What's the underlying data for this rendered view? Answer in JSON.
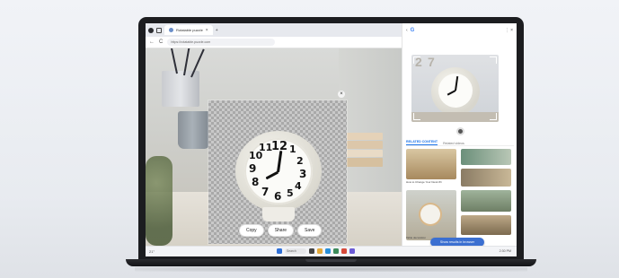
{
  "browser": {
    "tab_title": "Rotatable puzzle",
    "tab_close": "×",
    "tab_new": "+",
    "url": "https://rotatable.puzzle.com",
    "nav_back": "←",
    "nav_forward": "→",
    "nav_reload": "C"
  },
  "image": {
    "clock_numerals": [
      "12",
      "1",
      "2",
      "3",
      "4",
      "5",
      "6",
      "7",
      "8",
      "9",
      "10",
      "11"
    ],
    "close_glyph": "×"
  },
  "actions": {
    "copy": "Copy",
    "share": "Share",
    "save": "Save"
  },
  "search_panel": {
    "logo": "G",
    "window_controls": "⋮  ×",
    "preview_numbers": [
      "2",
      "7"
    ],
    "tabs": [
      "RELATED CONTENT",
      "Related videos"
    ],
    "results": [
      {
        "caption": "How to Change Your Desk Wi"
      },
      {
        "caption": "Table decoration"
      }
    ],
    "cta": "Show results in browser"
  },
  "taskbar": {
    "weather": "21°",
    "search": "Search",
    "clock": "2:30 PM"
  },
  "colors": {
    "accent": "#3b6fd1",
    "bezel": "#1c1d20"
  }
}
